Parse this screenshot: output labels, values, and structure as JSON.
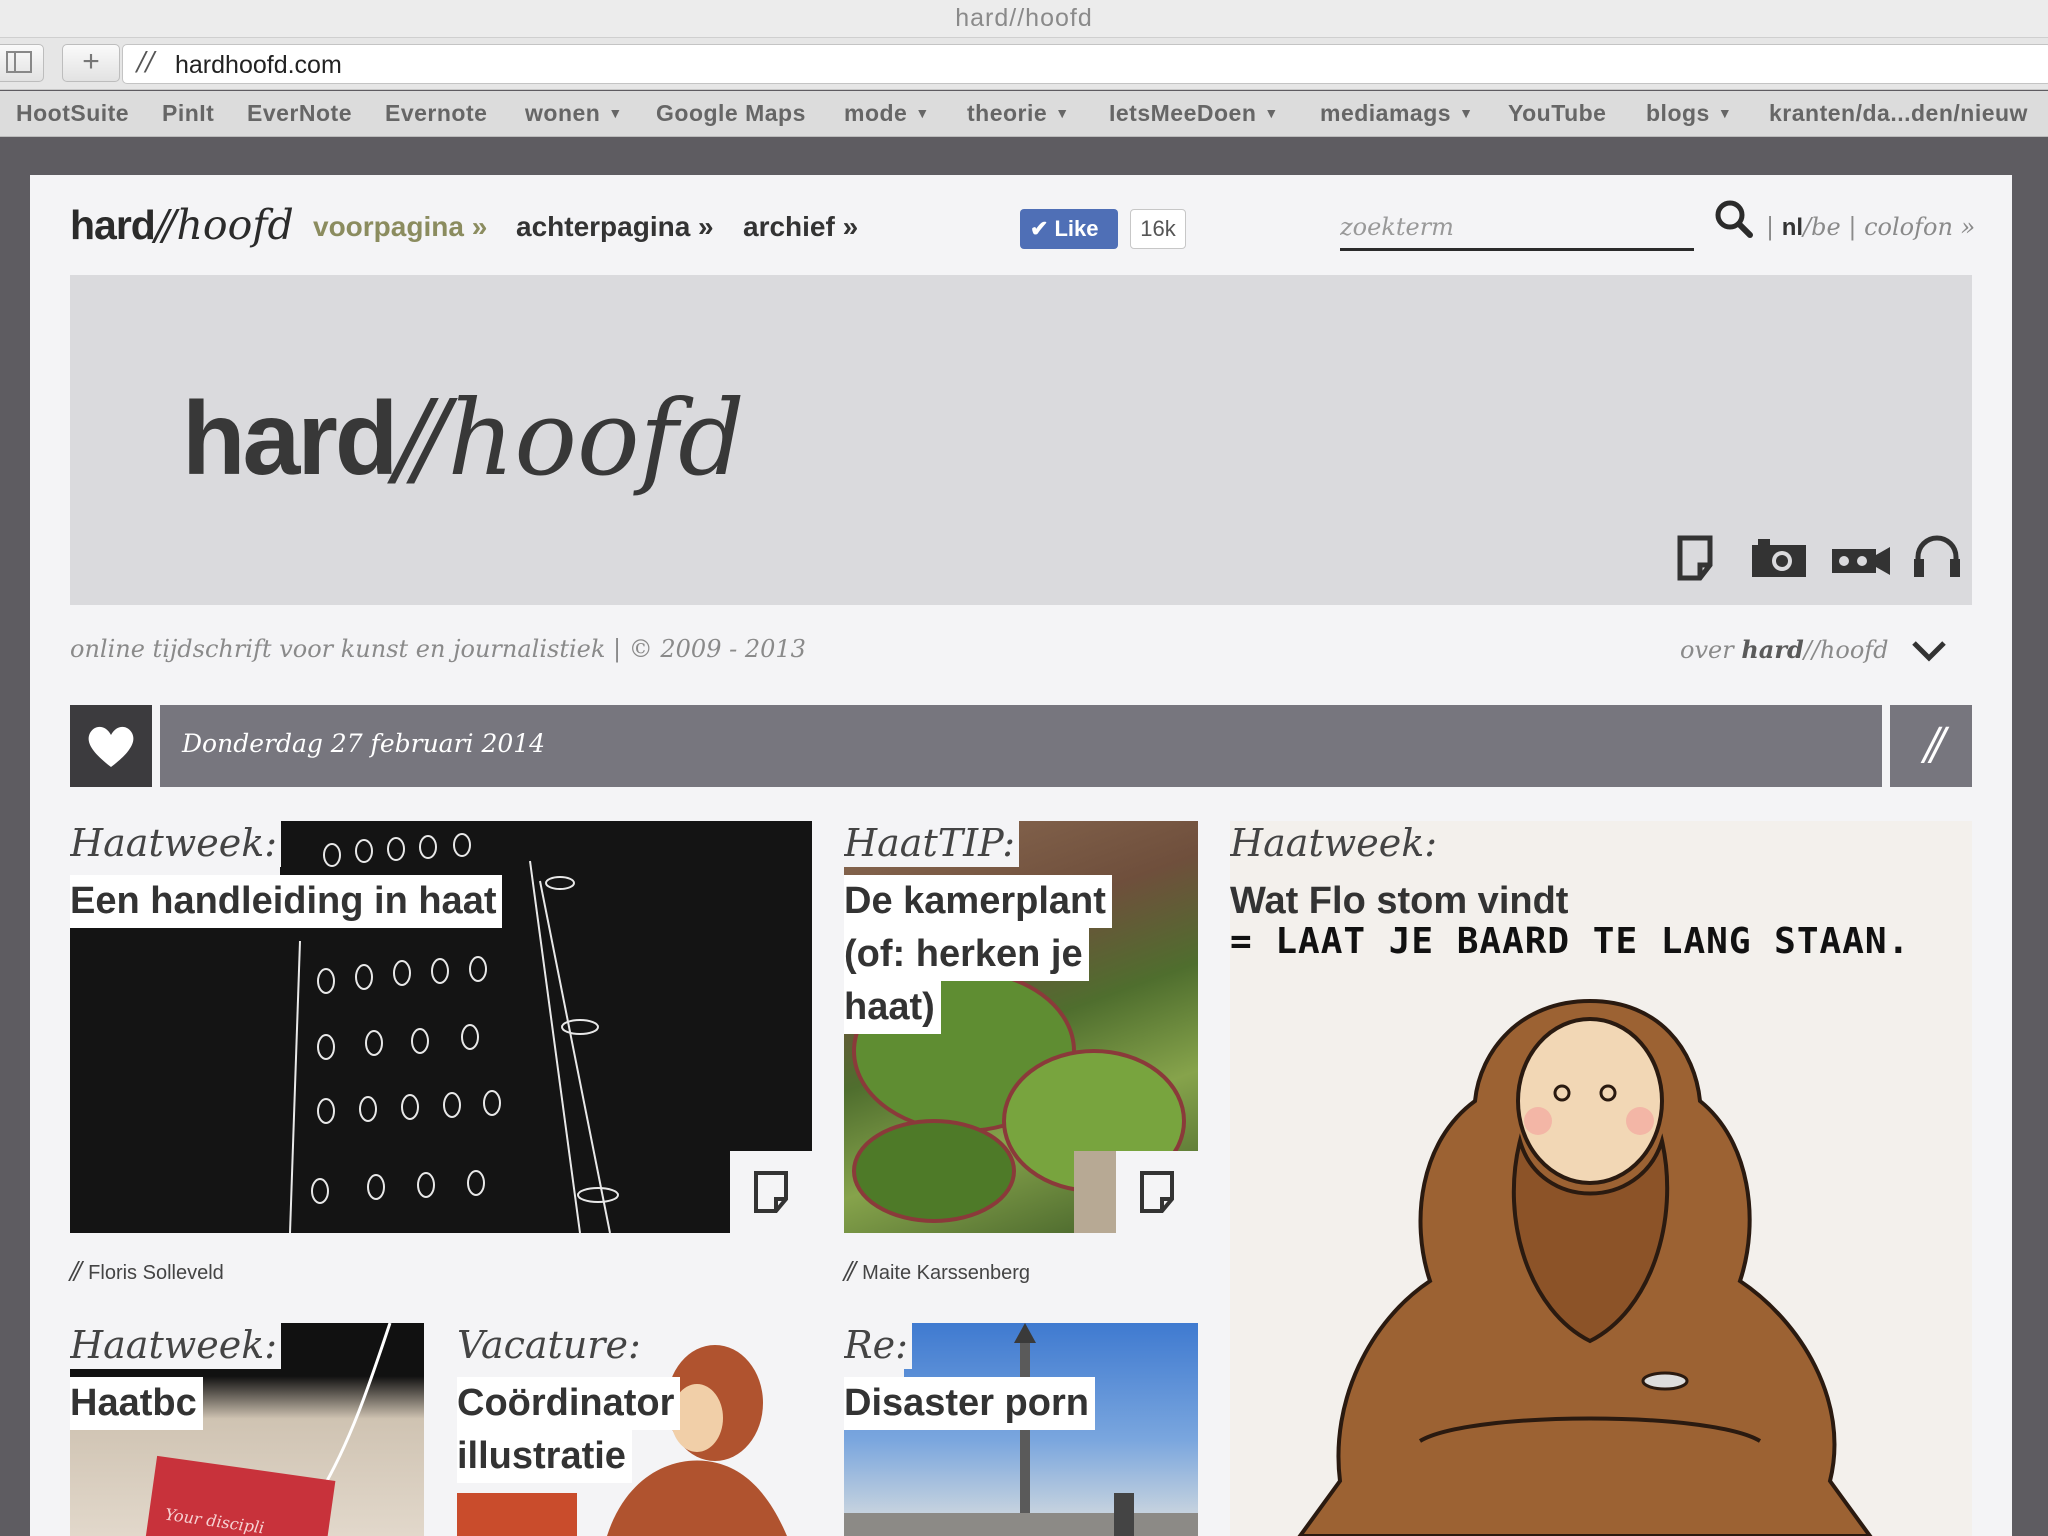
{
  "browser": {
    "window_title": "hard//hoofd",
    "url": "hardhoofd.com",
    "favicon_text": "//",
    "new_tab_symbol": "+"
  },
  "bookmarks": [
    {
      "label": "HootSuite",
      "has_menu": false
    },
    {
      "label": "PinIt",
      "has_menu": false
    },
    {
      "label": "EverNote",
      "has_menu": false
    },
    {
      "label": "Evernote",
      "has_menu": false
    },
    {
      "label": "wonen",
      "has_menu": true
    },
    {
      "label": "Google Maps",
      "has_menu": false
    },
    {
      "label": "mode",
      "has_menu": true
    },
    {
      "label": "theorie",
      "has_menu": true
    },
    {
      "label": "IetsMeeDoen",
      "has_menu": true
    },
    {
      "label": "mediamags",
      "has_menu": true
    },
    {
      "label": "YouTube",
      "has_menu": false
    },
    {
      "label": "blogs",
      "has_menu": true
    },
    {
      "label": "kranten/da...den/nieuw",
      "has_menu": false
    }
  ],
  "header": {
    "logo_bold": "hard",
    "logo_slash": "//",
    "logo_italic": "hoofd",
    "nav": [
      {
        "label": "voorpagina »",
        "active": true
      },
      {
        "label": "achterpagina »",
        "active": false
      },
      {
        "label": "archief »",
        "active": false
      }
    ],
    "like_label": "Like",
    "like_count": "16k",
    "search_placeholder": "zoekterm",
    "lang_sep1": "|",
    "lang_nl": "nl",
    "lang_be": "/be",
    "lang_sep2": "|",
    "colofon": "colofon »"
  },
  "banner": {
    "logo_bold": "hard",
    "logo_slash": "//",
    "logo_italic": "hoofd",
    "media_icons": [
      "document-icon",
      "camera-icon",
      "video-camera-icon",
      "headphones-icon"
    ]
  },
  "tagline": "online tijdschrift voor kunst en journalistiek | © 2009 - 2013",
  "about": {
    "prefix": "over ",
    "bold": "hard",
    "slash": "//",
    "rest": "hoofd"
  },
  "date_bar": {
    "date": "Donderdag 27 februari 2014",
    "slash": "//"
  },
  "articles": [
    {
      "category": "Haatweek:",
      "title_lines": [
        "Een handleiding in haat"
      ],
      "author": "Floris Solleveld"
    },
    {
      "category": "HaatTIP:",
      "title_lines": [
        "De kamerplant",
        "(of: herken je",
        "haat)"
      ],
      "author": "Maite Karssenberg"
    },
    {
      "category": "Haatweek:",
      "title_lines": [
        "Wat Flo stom vindt"
      ],
      "comic_text": "= LAAT JE BAARD TE LANG STAAN."
    },
    {
      "category": "Haatweek:",
      "title_lines": [
        "Haatbc"
      ],
      "tag_text": "Your discipli"
    },
    {
      "category": "Vacature:",
      "title_lines": [
        "Coördinator",
        "illustratie"
      ]
    },
    {
      "category": "Re:",
      "title_lines": [
        "Disaster porn"
      ]
    }
  ],
  "colors": {
    "accent_olive": "#8b8c5f",
    "date_bar": "#77767e",
    "heart_box": "#3c3b3e",
    "facebook": "#4f6fb6"
  }
}
